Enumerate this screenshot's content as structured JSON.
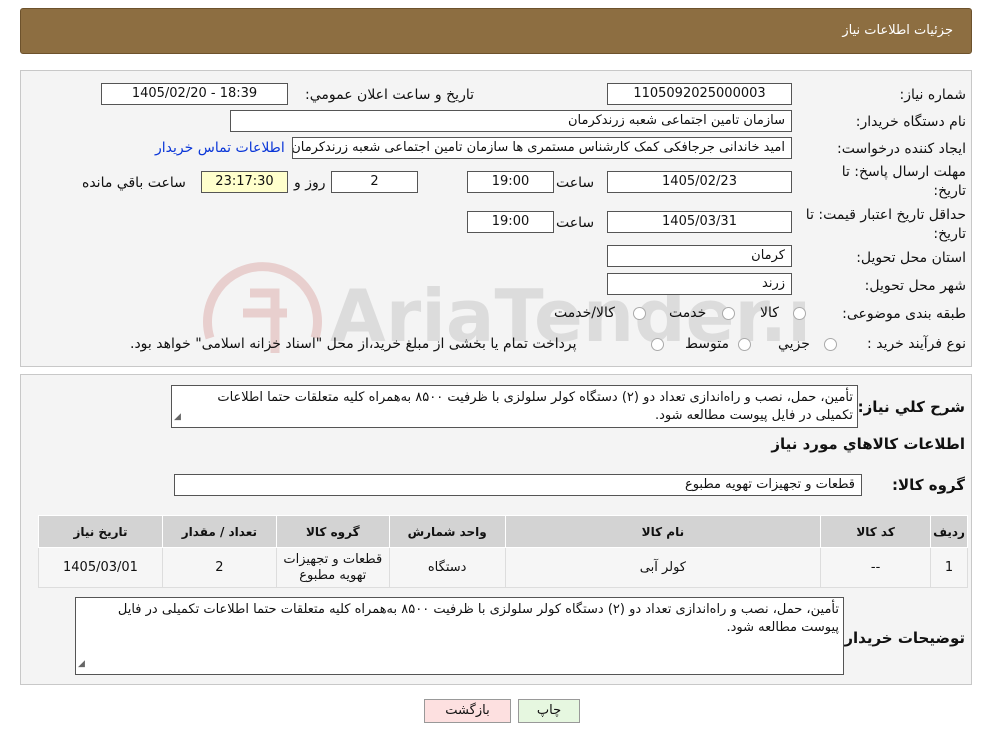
{
  "header": {
    "title": "جزئیات اطلاعات نیاز"
  },
  "watermark": {
    "text": "AriaTender.neT"
  },
  "form": {
    "need_number_label": "شماره نیاز:",
    "need_number": "1105092025000003",
    "announce_label": "تاریخ و ساعت اعلان عمومي:",
    "announce_value": "1405/02/20 - 18:39",
    "buyer_org_label": "نام دستگاه خریدار:",
    "buyer_org": "سازمان تامین اجتماعی شعبه زرندکرمان",
    "requester_label": "ایجاد کننده درخواست:",
    "requester": "امید خاندانی جرجافکی کمک کارشناس مستمری ها  سازمان تامین اجتماعی شعبه زرندکرمان",
    "contact_link": "اطلاعات تماس خریدار",
    "deadline_label_1": "مهلت ارسال پاسخ: تا",
    "deadline_label_2": "تاریخ:",
    "deadline_date": "1405/02/23",
    "time_label": "ساعت",
    "deadline_time": "19:00",
    "days_value": "2",
    "days_label": "روز و",
    "remaining_time": "23:17:30",
    "remaining_label": "ساعت باقي مانده",
    "validity_label_1": "حداقل تاریخ اعتبار قیمت: تا",
    "validity_label_2": "تاریخ:",
    "validity_date": "1405/03/31",
    "validity_time": "19:00",
    "province_label": "استان محل تحویل:",
    "province": "کرمان",
    "city_label": "شهر محل تحویل:",
    "city": "زرند",
    "category_label": "طبقه بندی موضوعی:",
    "category_options": [
      "کالا",
      "خدمت",
      "کالا/خدمت"
    ],
    "process_label": "نوع فرآیند خرید :",
    "process_options": [
      "جزیي",
      "متوسط"
    ],
    "process_note": "پرداخت تمام یا بخشی از مبلغ خرید،از محل \"اسناد خزانه اسلامی\" خواهد بود."
  },
  "summary": {
    "label": "شرح کلي نیاز:",
    "text": "تأمین، حمل، نصب و راه‌اندازی تعداد دو (۲) دستگاه کولر سلولزی با ظرفیت ۸۵۰۰ به‌همراه کلیه متعلقات حتما اطلاعات تکمیلی در فایل پیوست مطالعه شود."
  },
  "goods": {
    "section_title": "اطلاعات کالاهاي مورد نیاز",
    "group_label": "گروه کالا:",
    "group_value": "قطعات و تجهیزات تهویه مطبوع",
    "columns": [
      "ردیف",
      "کد کالا",
      "نام کالا",
      "واحد شمارش",
      "گروه کالا",
      "تعداد / مقدار",
      "تاریخ نیاز"
    ],
    "rows": [
      {
        "index": "1",
        "code": "--",
        "name": "کولر آبی",
        "unit": "دستگاه",
        "group": "قطعات و تجهیزات تهویه مطبوع",
        "qty": "2",
        "date": "1405/03/01"
      }
    ]
  },
  "buyer_notes": {
    "label": "توضیحات خریدار:",
    "text": "تأمین، حمل، نصب و راه‌اندازی تعداد دو (۲) دستگاه کولر سلولزی با ظرفیت ۸۵۰۰ به‌همراه کلیه متعلقات حتما اطلاعات تکمیلی در فایل پیوست مطالعه شود."
  },
  "actions": {
    "print": "چاپ",
    "back": "بازگشت"
  },
  "colors": {
    "header": "#8d6e41",
    "link": "#0a36d8",
    "back_button": "#fde0e0",
    "print_button": "#e6f7e0",
    "remaining_box": "#ffffcc"
  }
}
